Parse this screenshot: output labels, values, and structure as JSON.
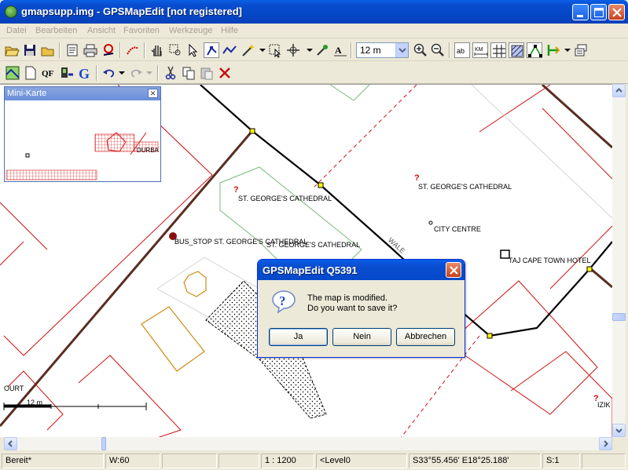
{
  "window": {
    "title": "gmapsupp.img - GPSMapEdit [not registered]"
  },
  "menu": [
    "Datei",
    "Bearbeiten",
    "Ansicht",
    "Favoriten",
    "Werkzeuge",
    "Hilfe"
  ],
  "toolbar": {
    "zoom_value": "12 m"
  },
  "minimap": {
    "title": "Mini-Karte",
    "label": "DURBA"
  },
  "map": {
    "labels": {
      "cathedral_1": "ST. GEORGE'S CATHEDRAL",
      "cathedral_2": "ST. GEORGE'S CATHEDRAL",
      "bus_stop": "BUS_STOP ST. GEORGE'S CATHEDRAL",
      "cathedral_3": "ST. GEORGE'S CATHEDRAL",
      "city_centre": "CITY CENTRE",
      "hotel": "TAJ CAPE TOWN HOTEL",
      "street": "WALE",
      "court": "OURT",
      "izik": "IZIK"
    },
    "scale_label": "12 m"
  },
  "dialog": {
    "title": "GPSMapEdit Q5391",
    "line1": "The map is modified.",
    "line2": "Do you want to save it?",
    "buttons": {
      "yes": "Ja",
      "no": "Nein",
      "cancel": "Abbrechen"
    }
  },
  "status": {
    "state": "Bereit*",
    "width": "W:60",
    "scale": "1 : 1200",
    "level": "<Level0",
    "coords": "S33°55.456' E18°25.188'",
    "selection": "S:1"
  },
  "colors": {
    "title_blue": "#0A4DD0",
    "road_black": "#000000",
    "road_brown": "#5A2D20",
    "outline_red": "#D01010",
    "node_yellow": "#FFFF00",
    "close_red": "#C8401A"
  }
}
